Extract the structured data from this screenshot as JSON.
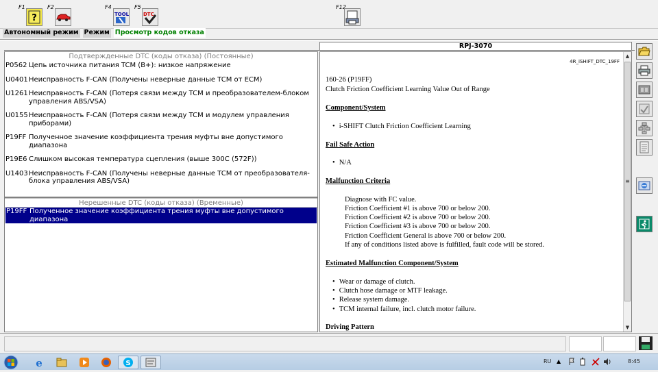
{
  "toolbar": {
    "keys": [
      {
        "key": "F1",
        "icon": "help-question-icon"
      },
      {
        "key": "F2",
        "icon": "car-icon"
      },
      {
        "key": "F4",
        "icon": "tool-icon"
      },
      {
        "key": "F5",
        "icon": "dtc-icon"
      },
      {
        "key": "F12",
        "icon": "print-screen-icon"
      }
    ],
    "tool_label": "TOOL",
    "dtc_label": "DTC"
  },
  "modes": {
    "offline": "Автономный режим",
    "mode": "Режим",
    "view": "Просмотр кодов отказа"
  },
  "header": {
    "title": "RPJ-3070"
  },
  "confirmed": {
    "title": "Подтвержденные DTC (коды отказа) (Постоянные)",
    "rows": [
      {
        "code": "P0562",
        "desc": "Цепь источника питания TCM (B+): низкое напряжение"
      },
      {
        "code": "U0401",
        "desc": "Неисправность F-CAN (Получены неверные данные TCM от ECM)"
      },
      {
        "code": "U1261",
        "desc": "Неисправность F-CAN (Потеря связи между TCM и преобразователем-блоком управления ABS/VSA)"
      },
      {
        "code": "U0155",
        "desc": "Неисправность F-CAN (Потеря связи между TCM и модулем управления приборами)"
      },
      {
        "code": "P19FF",
        "desc": "Полученное значение коэффициента трения муфты вне допустимого диапазона"
      },
      {
        "code": "P19E6",
        "desc": "Слишком высокая температура сцепления (выше 300C (572F))"
      },
      {
        "code": "U1403",
        "desc": "Неисправность F-CAN (Получены неверные данные TCM от преобразователя-блока управления ABS/VSA)"
      }
    ]
  },
  "pending": {
    "title": "Нерешенные DTC (коды отказа) (Временные)",
    "rows": [
      {
        "code": "P19FF",
        "desc": "Полученное значение коэффициента трения муфты вне допустимого диапазона"
      }
    ]
  },
  "doc": {
    "id": "4R_iSHIFT_DTC_19FF",
    "code_line": "160-26 (P19FF)",
    "title": "Clutch Friction Coefficient Learning Value Out of Range",
    "component_head": "Component/System",
    "component_item": "i-SHIFT Clutch Friction Coefficient Learning",
    "failsafe_head": "Fail Safe Action",
    "failsafe_item": "N/A",
    "criteria_head": "Malfunction Criteria",
    "criteria_lines": [
      "Diagnose with FC value.",
      "Friction Coefficient #1 is above 700 or below 200.",
      "Friction Coefficient #2 is above 700 or below 200.",
      "Friction Coefficient #3 is above 700 or below 200.",
      "Friction Coefficient General is above 700 or below 200.",
      "If any of conditions listed above is fulfilled, fault code will be stored."
    ],
    "estimated_head": "Estimated Malfunction Component/System",
    "estimated_items": [
      "Wear or damage of clutch.",
      "Clutch hose damage or MTF leakage.",
      "Release system damage.",
      "TCM internal failure, incl. clutch motor failure."
    ],
    "driving_head": "Driving Pattern"
  },
  "side_buttons": [
    "open-folder-icon",
    "printer-icon",
    "film-icon",
    "dtc-list-icon",
    "tree-icon",
    "notepad-icon",
    "refresh-icon",
    "exit-icon"
  ],
  "taskbar": {
    "lang": "RU",
    "time": "8:45",
    "apps": [
      "ie-icon",
      "explorer-icon",
      "media-player-icon",
      "firefox-icon",
      "skype-icon",
      "diagnostic-app-icon"
    ]
  },
  "colors": {
    "selection": "#00008b",
    "mode_view_text": "#008000",
    "panel_title": "#808080"
  }
}
